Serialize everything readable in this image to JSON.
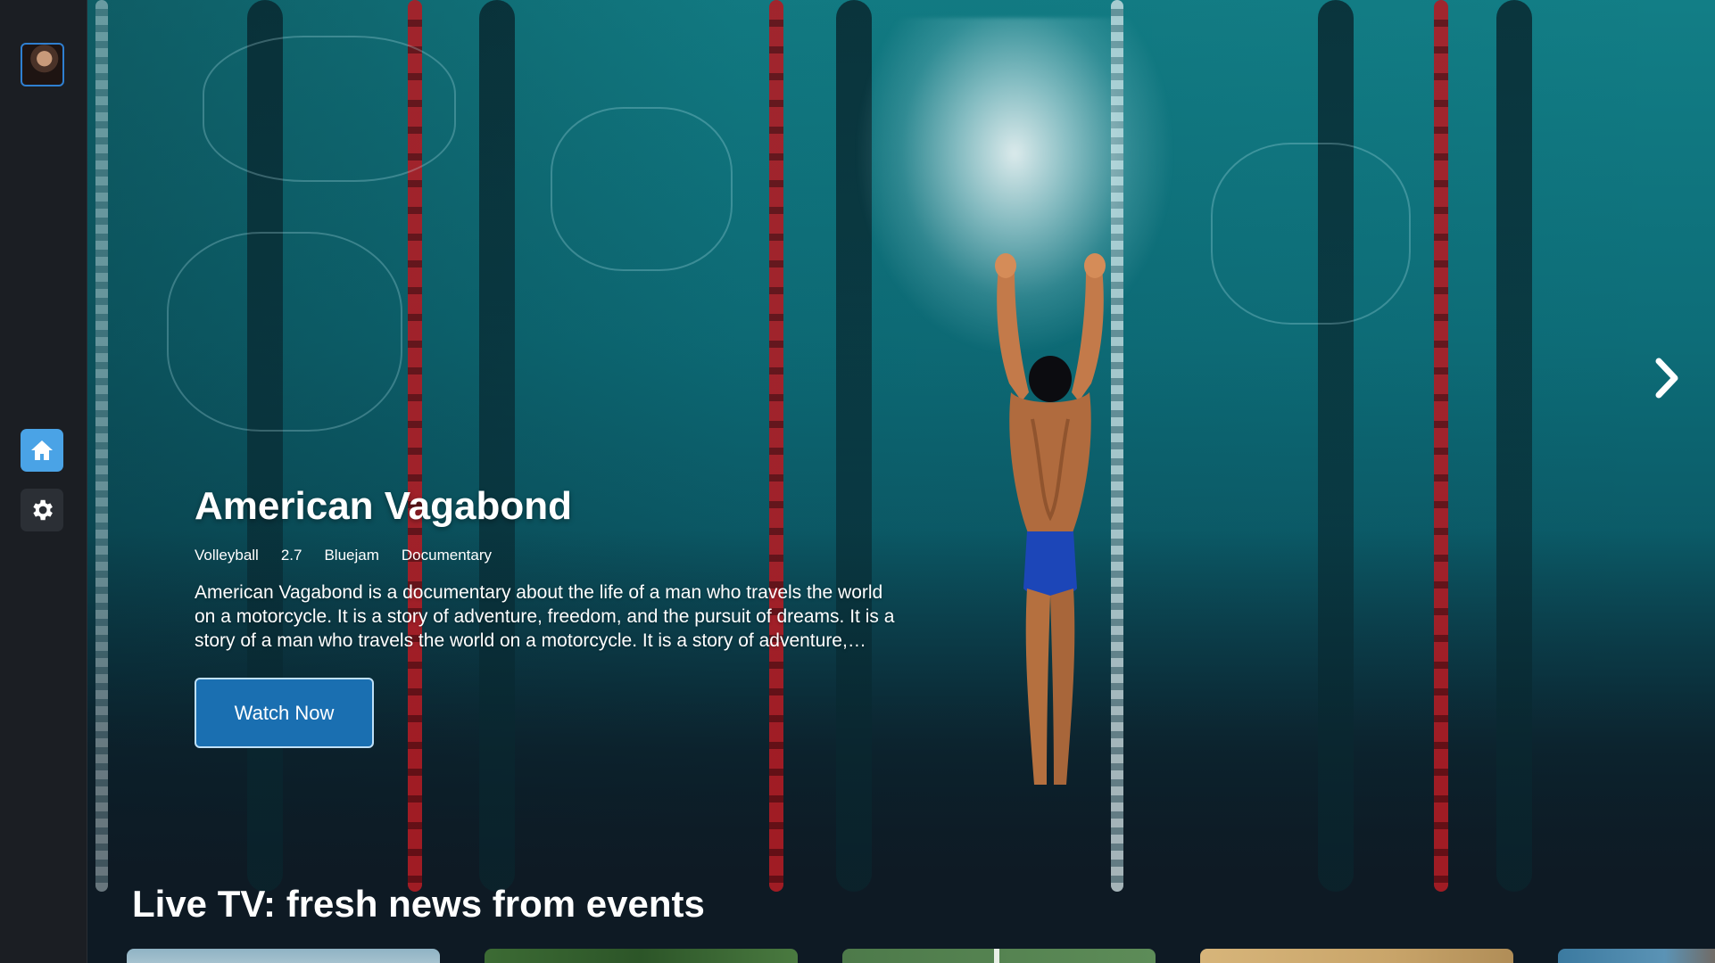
{
  "sidebar": {
    "avatar_alt": "",
    "home_icon": "home-icon",
    "settings_icon": "gear-icon",
    "accent": "#4aa3e6"
  },
  "hero": {
    "title": "American Vagabond",
    "meta": [
      "Volleyball",
      "2.7",
      "Bluejam",
      "Documentary"
    ],
    "description": "American Vagabond is a documentary about the life of a man who travels the world on a motorcycle. It is a story of adventure, freedom, and the pursuit of dreams. It is a story of a man who travels the world on a motorcycle. It is a story of adventure, freedom, and the pursuit of dreams.",
    "watch_label": "Watch Now",
    "next_icon": "chevron-right-icon",
    "button_color": "#1a6fb1"
  },
  "live_tv": {
    "title": "Live TV: fresh news from events",
    "cards": [
      {
        "thumb": "sky-landscape",
        "color": "#8fb3c4"
      },
      {
        "thumb": "green-field",
        "color": "#3c6b34"
      },
      {
        "thumb": "green-pitch",
        "color": "#4d7a4a"
      },
      {
        "thumb": "sand-beach",
        "color": "#c9a56a"
      },
      {
        "thumb": "blue-sea",
        "color": "#3b7aa0"
      }
    ]
  }
}
